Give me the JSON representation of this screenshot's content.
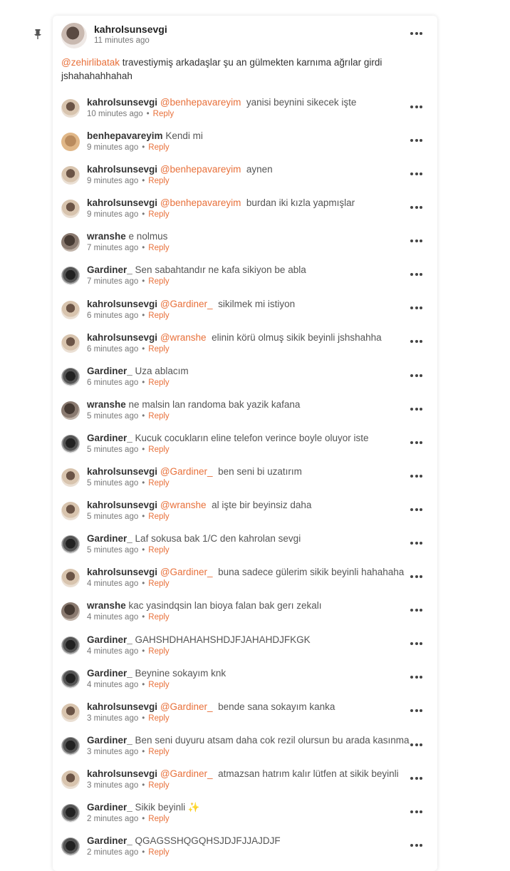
{
  "post": {
    "author": "kahrolsunsevgi",
    "time": "11 minutes ago",
    "mention": "@zehirlibatak",
    "text": " travestiymiş arkadaşlar şu an gülmekten karnıma ağrılar girdi jshahahahhahah"
  },
  "reply_label": "Reply",
  "comments": [
    {
      "author": "kahrolsunsevgi",
      "avatar": "kahrol",
      "mention": "@benhepavareyim",
      "text": "yanisi beynini sikecek işte",
      "time": "10 minutes ago"
    },
    {
      "author": "benhepavareyim",
      "avatar": "benhepa",
      "mention": "",
      "text": "Kendi mi",
      "time": "9 minutes ago"
    },
    {
      "author": "kahrolsunsevgi",
      "avatar": "kahrol",
      "mention": "@benhepavareyim",
      "text": "aynen",
      "time": "9 minutes ago"
    },
    {
      "author": "kahrolsunsevgi",
      "avatar": "kahrol",
      "mention": "@benhepavareyim",
      "text": "burdan iki kızla yapmışlar",
      "time": "9 minutes ago"
    },
    {
      "author": "wranshe",
      "avatar": "wranshe",
      "mention": "",
      "text": "e nolmus",
      "time": "7 minutes ago"
    },
    {
      "author": "Gardiner_",
      "avatar": "gardiner",
      "mention": "",
      "text": "Sen sabahtandır ne kafa sikiyon be abla",
      "time": "7 minutes ago"
    },
    {
      "author": "kahrolsunsevgi",
      "avatar": "kahrol",
      "mention": "@Gardiner_",
      "text": "sikilmek mi istiyon",
      "time": "6 minutes ago"
    },
    {
      "author": "kahrolsunsevgi",
      "avatar": "kahrol",
      "mention": "@wranshe",
      "text": "elinin körü olmuş sikik beyinli jshshahha",
      "time": "6 minutes ago"
    },
    {
      "author": "Gardiner_",
      "avatar": "gardiner",
      "mention": "",
      "text": "Uza ablacım",
      "time": "6 minutes ago"
    },
    {
      "author": "wranshe",
      "avatar": "wranshe",
      "mention": "",
      "text": "ne malsin lan randoma bak yazik kafana",
      "time": "5 minutes ago"
    },
    {
      "author": "Gardiner_",
      "avatar": "gardiner",
      "mention": "",
      "text": "Kucuk cocukların eline telefon verince boyle oluyor iste",
      "time": "5 minutes ago"
    },
    {
      "author": "kahrolsunsevgi",
      "avatar": "kahrol",
      "mention": "@Gardiner_",
      "text": "ben seni bi uzatırım",
      "time": "5 minutes ago"
    },
    {
      "author": "kahrolsunsevgi",
      "avatar": "kahrol",
      "mention": "@wranshe",
      "text": "al işte bir beyinsiz daha",
      "time": "5 minutes ago"
    },
    {
      "author": "Gardiner_",
      "avatar": "gardiner",
      "mention": "",
      "text": "Laf sokusa bak 1/C den kahrolan sevgi",
      "time": "5 minutes ago"
    },
    {
      "author": "kahrolsunsevgi",
      "avatar": "kahrol",
      "mention": "@Gardiner_",
      "text": "buna sadece gülerim sikik beyinli hahahaha",
      "time": "4 minutes ago"
    },
    {
      "author": "wranshe",
      "avatar": "wranshe",
      "mention": "",
      "text": "kac yasindqsin lan bioya falan bak gerı zekalı",
      "time": "4 minutes ago"
    },
    {
      "author": "Gardiner_",
      "avatar": "gardiner",
      "mention": "",
      "text": "GAHSHDHAHAHSHDJFJAHAHDJFKGK",
      "time": "4 minutes ago"
    },
    {
      "author": "Gardiner_",
      "avatar": "gardiner",
      "mention": "",
      "text": "Beynine sokayım knk",
      "time": "4 minutes ago"
    },
    {
      "author": "kahrolsunsevgi",
      "avatar": "kahrol",
      "mention": "@Gardiner_",
      "text": "bende sana sokayım kanka",
      "time": "3 minutes ago"
    },
    {
      "author": "Gardiner_",
      "avatar": "gardiner",
      "mention": "",
      "text": "Ben seni duyuru atsam daha cok rezil olursun bu arada kasınma",
      "time": "3 minutes ago"
    },
    {
      "author": "kahrolsunsevgi",
      "avatar": "kahrol",
      "mention": "@Gardiner_",
      "text": "atmazsan hatrım kalır lütfen at sikik beyinli",
      "time": "3 minutes ago"
    },
    {
      "author": "Gardiner_",
      "avatar": "gardiner",
      "mention": "",
      "text": "Sikik beyinli ✨",
      "time": "2 minutes ago"
    },
    {
      "author": "Gardiner_",
      "avatar": "gardiner",
      "mention": "",
      "text": "QGAGSSHQGQHSJDJFJJAJDJF",
      "time": "2 minutes ago"
    }
  ]
}
